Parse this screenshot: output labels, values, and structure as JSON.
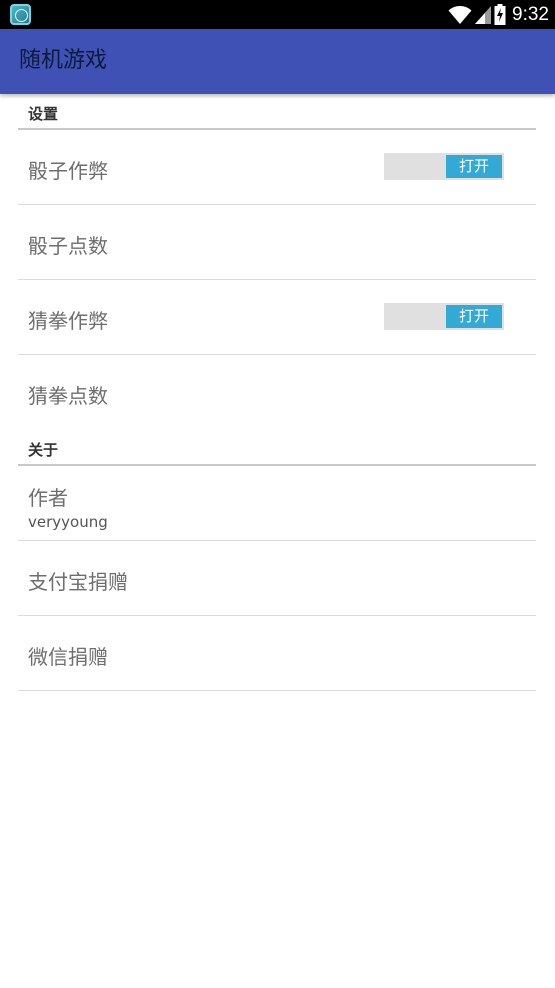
{
  "status_bar": {
    "time": "9:32",
    "app_icon": "app-notification-icon",
    "icons": [
      "wifi-icon",
      "signal-icon",
      "battery-charging-icon"
    ]
  },
  "app_bar": {
    "title": "随机游戏",
    "background": "#3f51b5"
  },
  "sections": {
    "settings": {
      "header": "设置",
      "items": {
        "dice_cheat": {
          "title": "骰子作弊",
          "switch_label": "打开"
        },
        "dice_points": {
          "title": "骰子点数"
        },
        "rps_cheat": {
          "title": "猜拳作弊",
          "switch_label": "打开"
        },
        "rps_points": {
          "title": "猜拳点数"
        }
      }
    },
    "about": {
      "header": "关于",
      "items": {
        "author": {
          "title": "作者",
          "summary": "veryyoung"
        },
        "alipay": {
          "title": "支付宝捐赠"
        },
        "wechat": {
          "title": "微信捐赠"
        }
      }
    }
  },
  "colors": {
    "accent": "#33a9d6",
    "toolbar": "#3f51b5"
  }
}
